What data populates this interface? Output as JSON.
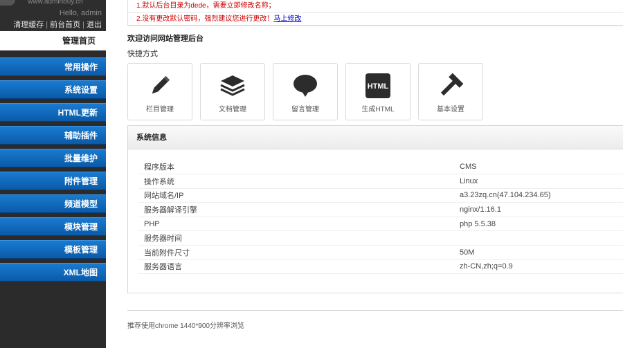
{
  "sidebar": {
    "logo_url": "www.adminbuy.cn",
    "greeting": "Hello, admin",
    "links": [
      "清理缓存",
      "前台首页",
      "退出"
    ],
    "home_label": "管理首页",
    "items": [
      {
        "label": "常用操作"
      },
      {
        "label": "系统设置"
      },
      {
        "label": "HTML更新"
      },
      {
        "label": "辅助插件"
      },
      {
        "label": "批量维护"
      },
      {
        "label": "附件管理"
      },
      {
        "label": "频道模型"
      },
      {
        "label": "模块管理"
      },
      {
        "label": "模板管理"
      },
      {
        "label": "XML地图"
      }
    ]
  },
  "notice": {
    "line1": "1.默认后台目录为dede，需要立即修改名称；",
    "line2_text": "2.没有更改默认密码，强烈建议您进行更改！",
    "line2_link": "马上修改"
  },
  "welcome": "欢迎访问网站管理后台",
  "quick_title": "快捷方式",
  "shortcuts": [
    {
      "label": "栏目管理",
      "icon": "pencil-icon"
    },
    {
      "label": "文档管理",
      "icon": "stack-icon"
    },
    {
      "label": "留言管理",
      "icon": "speech-bubble-icon"
    },
    {
      "label": "生成HTML",
      "icon": "html-icon",
      "icon_text": "HTML"
    },
    {
      "label": "基本设置",
      "icon": "hammer-icon"
    }
  ],
  "sysinfo": {
    "title": "系统信息",
    "rows": [
      {
        "key": "程序版本",
        "value": "CMS"
      },
      {
        "key": "操作系统",
        "value": "Linux"
      },
      {
        "key": "网站域名/IP",
        "value": "a3.23zq.cn(47.104.234.65)"
      },
      {
        "key": "服务器解译引擎",
        "value": "nginx/1.16.1"
      },
      {
        "key": "PHP",
        "value": "php 5.5.38"
      },
      {
        "key": "服务器时间",
        "value": ""
      },
      {
        "key": "当前附件尺寸",
        "value": "50M"
      },
      {
        "key": "服务器语言",
        "value": "zh-CN,zh;q=0.9"
      }
    ]
  },
  "footer": "推荐使用chrome 1440*900分辨率浏览",
  "colors": {
    "nav_blue": "#0a5aa8",
    "sidebar_bg": "#2b2b2b",
    "notice_red": "#cc0000"
  }
}
